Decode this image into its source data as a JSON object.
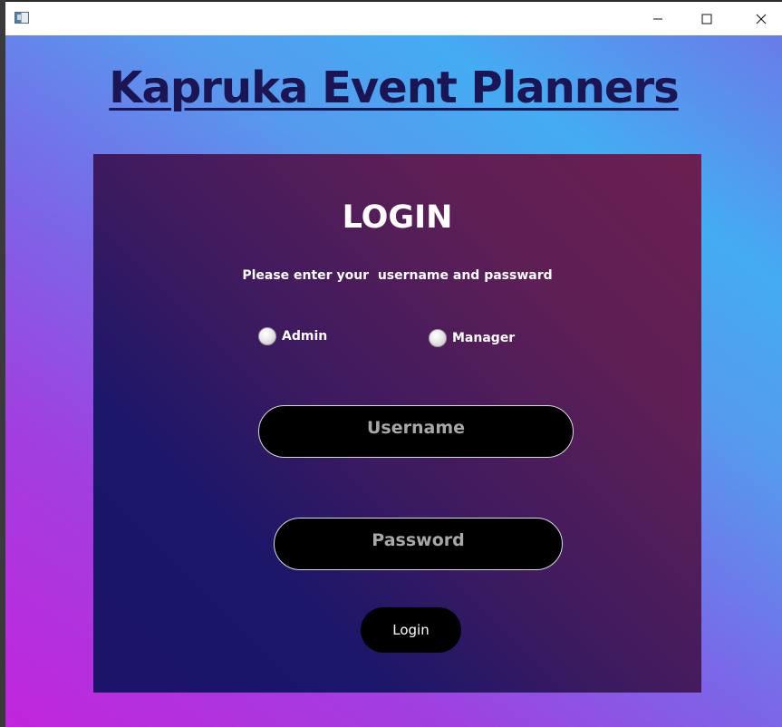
{
  "window": {
    "icon": "app-window-icon",
    "controls": {
      "minimize_icon": "minimize-icon",
      "maximize_icon": "maximize-icon",
      "close_icon": "close-icon"
    }
  },
  "header": {
    "title": "Kapruka Event Planners"
  },
  "login": {
    "heading": "LOGIN",
    "subtitle": "Please enter your  username and passward",
    "roles": [
      {
        "label": "Admin",
        "selected": false
      },
      {
        "label": "Manager",
        "selected": false
      }
    ],
    "username": {
      "placeholder": "Username",
      "value": ""
    },
    "password": {
      "placeholder": "Password",
      "value": ""
    },
    "button_label": "Login"
  },
  "colors": {
    "title_text": "#1b1553",
    "panel_dark": "#1a166a",
    "panel_maroon": "#6b1f50",
    "input_bg": "#000000",
    "placeholder_text": "#a8a8a8"
  }
}
